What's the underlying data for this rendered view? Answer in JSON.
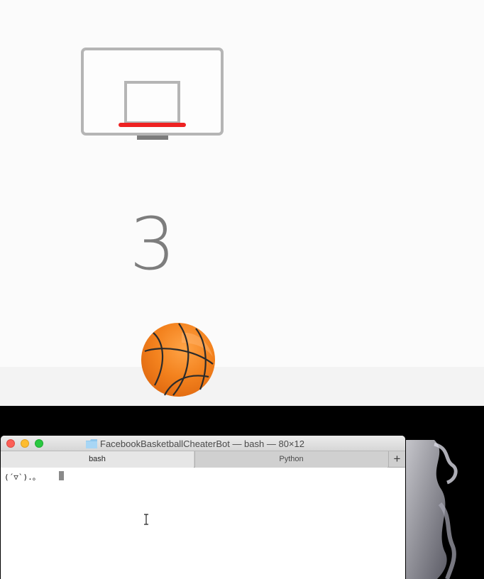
{
  "game": {
    "score": "3",
    "colors": {
      "background": "#fbfbfb",
      "backboard": "#b5b5b5",
      "rim": "#ee2222",
      "score": "#7d7d7d",
      "ball": "#f3821e"
    }
  },
  "terminal": {
    "title": "FacebookBasketballCheaterBot — bash — 80×12",
    "tabs": [
      {
        "label": "bash",
        "active": true
      },
      {
        "label": "Python",
        "active": false
      }
    ],
    "new_tab_label": "+",
    "prompt_text": "(´▽`).。",
    "icons": [
      "folder-icon",
      "close-icon",
      "minimize-icon",
      "zoom-icon",
      "text-cursor-icon"
    ]
  }
}
